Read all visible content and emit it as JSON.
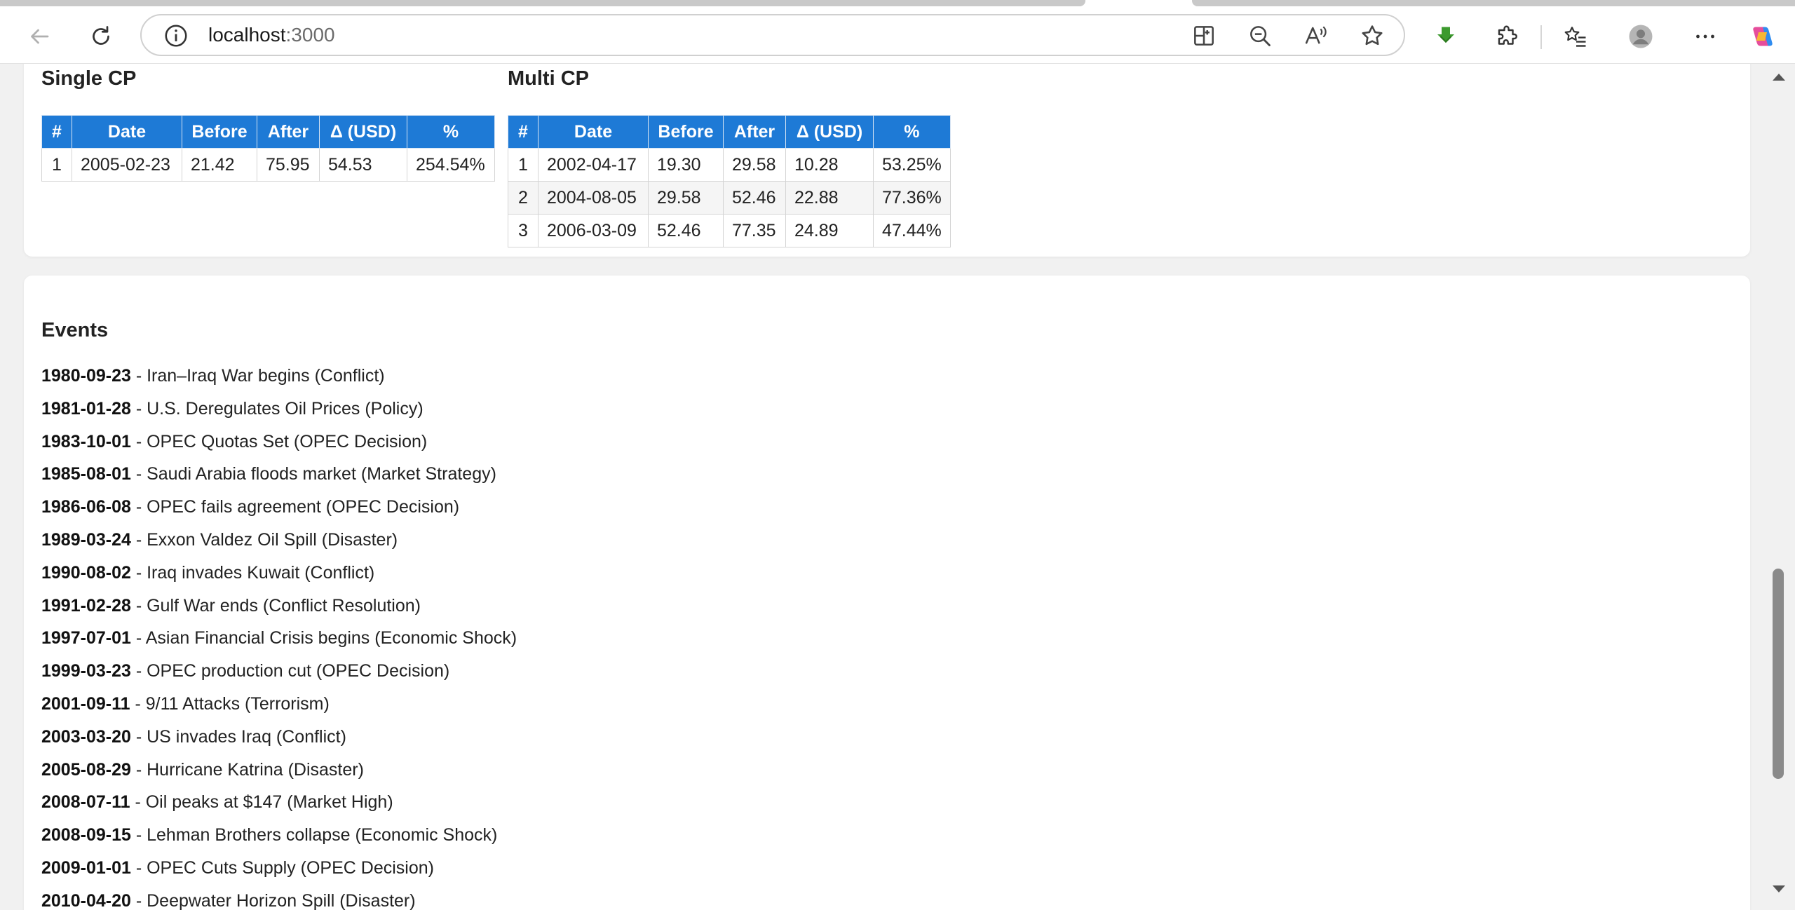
{
  "browser": {
    "url_host": "localhost",
    "url_port": ":3000",
    "icons": [
      "back-icon",
      "reload-icon",
      "site-info-icon",
      "split-screen-icon",
      "zoom-out-icon",
      "read-aloud-icon",
      "favorite-star-icon",
      "download-icon",
      "extensions-icon",
      "favorites-list-icon",
      "profile-icon",
      "more-icon",
      "copilot-icon"
    ],
    "colors": {
      "accent": "#1e7ad6",
      "download_green": "#3c9a2e"
    }
  },
  "single_cp": {
    "title": "Single CP",
    "headers": [
      "#",
      "Date",
      "Before",
      "After",
      "Δ (USD)",
      "%"
    ],
    "rows": [
      [
        "1",
        "2005-02-23",
        "21.42",
        "75.95",
        "54.53",
        "254.54%"
      ]
    ]
  },
  "multi_cp": {
    "title": "Multi CP",
    "headers": [
      "#",
      "Date",
      "Before",
      "After",
      "Δ (USD)",
      "%"
    ],
    "rows": [
      [
        "1",
        "2002-04-17",
        "19.30",
        "29.58",
        "10.28",
        "53.25%"
      ],
      [
        "2",
        "2004-08-05",
        "29.58",
        "52.46",
        "22.88",
        "77.36%"
      ],
      [
        "3",
        "2006-03-09",
        "52.46",
        "77.35",
        "24.89",
        "47.44%"
      ]
    ]
  },
  "events": {
    "title": "Events",
    "items": [
      {
        "date": "1980-09-23",
        "text": " - Iran–Iraq War begins (Conflict)"
      },
      {
        "date": "1981-01-28",
        "text": " - U.S. Deregulates Oil Prices (Policy)"
      },
      {
        "date": "1983-10-01",
        "text": " - OPEC Quotas Set (OPEC Decision)"
      },
      {
        "date": "1985-08-01",
        "text": " - Saudi Arabia floods market (Market Strategy)"
      },
      {
        "date": "1986-06-08",
        "text": " - OPEC fails agreement (OPEC Decision)"
      },
      {
        "date": "1989-03-24",
        "text": " - Exxon Valdez Oil Spill (Disaster)"
      },
      {
        "date": "1990-08-02",
        "text": " - Iraq invades Kuwait (Conflict)"
      },
      {
        "date": "1991-02-28",
        "text": " - Gulf War ends (Conflict Resolution)"
      },
      {
        "date": "1997-07-01",
        "text": " - Asian Financial Crisis begins (Economic Shock)"
      },
      {
        "date": "1999-03-23",
        "text": " - OPEC production cut (OPEC Decision)"
      },
      {
        "date": "2001-09-11",
        "text": " - 9/11 Attacks (Terrorism)"
      },
      {
        "date": "2003-03-20",
        "text": " - US invades Iraq (Conflict)"
      },
      {
        "date": "2005-08-29",
        "text": " - Hurricane Katrina (Disaster)"
      },
      {
        "date": "2008-07-11",
        "text": " - Oil peaks at $147 (Market High)"
      },
      {
        "date": "2008-09-15",
        "text": " - Lehman Brothers collapse (Economic Shock)"
      },
      {
        "date": "2009-01-01",
        "text": " - OPEC Cuts Supply (OPEC Decision)"
      },
      {
        "date": "2010-04-20",
        "text": " - Deepwater Horizon Spill (Disaster)"
      }
    ]
  }
}
